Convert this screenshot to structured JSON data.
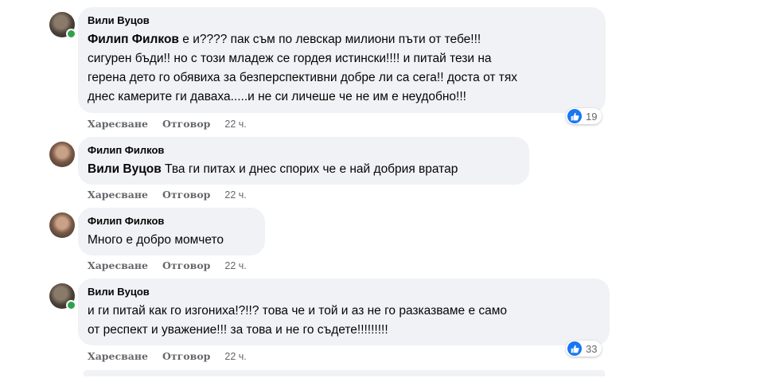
{
  "comments": [
    {
      "author": "Вили Вуцов",
      "mention": "Филип Филков",
      "text": " е и???? пак съм по левскар милиони пъти от тебе!!!\nсигурен бъди!! но с този младеж се гордея истински!!!! и питай тези на\nгерена дето го обявиха за безперспективни добре ли са сега!! доста от тях\nднес камерите ги даваха.....и не си личеше че не им е неудобно!!!",
      "like_label": "Харесване",
      "reply_label": "Отговор",
      "time": "22 ч.",
      "reactions": "19"
    },
    {
      "author": "Филип Филков",
      "mention": "Вили Вуцов",
      "text": " Тва ги питах и днес спорих че е най добрия вратар",
      "like_label": "Харесване",
      "reply_label": "Отговор",
      "time": "22 ч."
    },
    {
      "author": "Филип Филков",
      "text": "Много е добро момчето",
      "like_label": "Харесване",
      "reply_label": "Отговор",
      "time": "22 ч."
    },
    {
      "author": "Вили Вуцов",
      "text": "и ги питай как го изгониха!?!!? това че и той и аз не го разказваме е само\nот респект и уважение!!! за това и не го съдете!!!!!!!!!",
      "like_label": "Харесване",
      "reply_label": "Отговор",
      "time": "22 ч.",
      "reactions": "33"
    }
  ],
  "colors": {
    "bubble": "#f0f2f5",
    "like": "#1877f2",
    "online": "#31a24c",
    "meta": "#65676b"
  },
  "icons": {
    "reaction": "thumbs-up-icon"
  }
}
